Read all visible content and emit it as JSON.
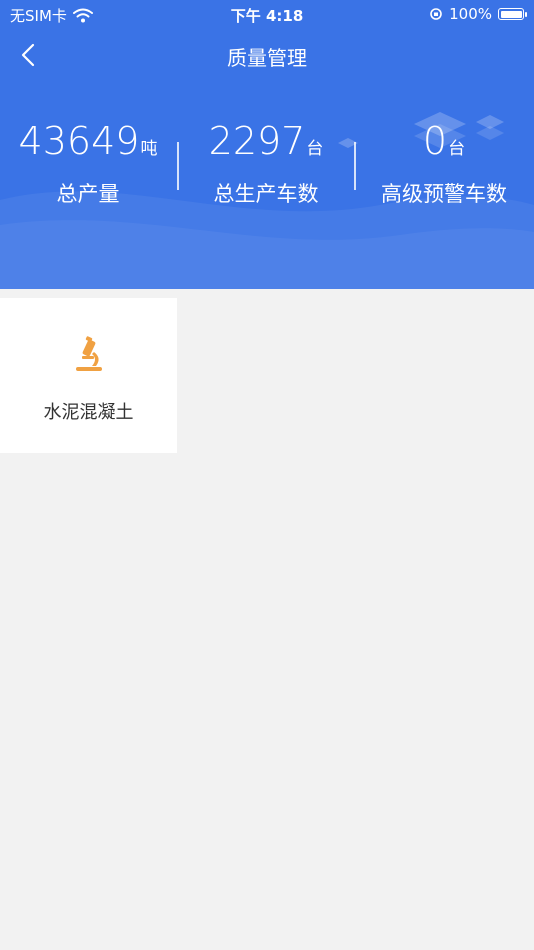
{
  "status_bar": {
    "carrier": "无SIM卡",
    "time": "下午 4:18",
    "battery": "100%"
  },
  "nav": {
    "title": "质量管理"
  },
  "stats": [
    {
      "value": "43649",
      "unit": "吨",
      "label": "总产量"
    },
    {
      "value": "2297",
      "unit": "台",
      "label": "总生产车数"
    },
    {
      "value": "0",
      "unit": "台",
      "label": "高级预警车数"
    }
  ],
  "modules": [
    {
      "label": "水泥混凝土",
      "icon": "microscope-icon"
    }
  ],
  "colors": {
    "header_bg": "#3a73e6",
    "page_bg": "#f2f2f2",
    "icon_accent": "#f0a142"
  }
}
